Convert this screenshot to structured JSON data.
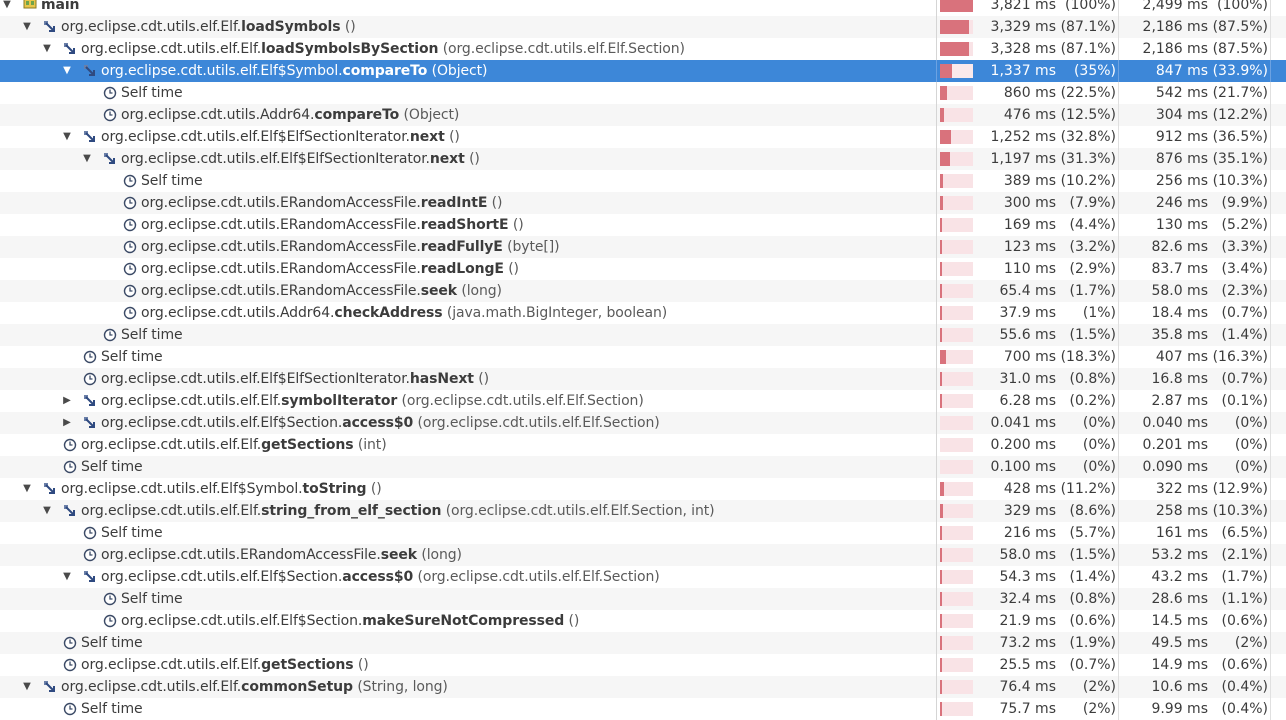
{
  "colors": {
    "selection": "#3d87d8",
    "bar_fill": "#d9727c",
    "bar_background": "#f9e3e6",
    "stripe": "#f6f6f6"
  },
  "rows": [
    {
      "name": "main",
      "args": "",
      "kind": "thread",
      "depth": 0,
      "expanded": true,
      "total_time": "3,821 ms",
      "total_pct": "(100%)",
      "cpu_time": "2,499 ms",
      "cpu_pct": "(100%)",
      "fraction": 1.0
    },
    {
      "prefix": "org.eclipse.cdt.utils.elf.Elf.",
      "name": "loadSymbols",
      "args": " ()",
      "kind": "method",
      "depth": 1,
      "expanded": true,
      "total_time": "3,329 ms",
      "total_pct": "(87.1%)",
      "cpu_time": "2,186 ms",
      "cpu_pct": "(87.5%)",
      "fraction": 0.871
    },
    {
      "prefix": "org.eclipse.cdt.utils.elf.Elf.",
      "name": "loadSymbolsBySection",
      "args": " (org.eclipse.cdt.utils.elf.Elf.Section)",
      "kind": "method",
      "depth": 2,
      "expanded": true,
      "total_time": "3,328 ms",
      "total_pct": "(87.1%)",
      "cpu_time": "2,186 ms",
      "cpu_pct": "(87.5%)",
      "fraction": 0.871
    },
    {
      "prefix": "org.eclipse.cdt.utils.elf.Elf$Symbol.",
      "name": "compareTo",
      "args": " (Object)",
      "kind": "method",
      "depth": 3,
      "expanded": true,
      "selected": true,
      "total_time": "1,337 ms",
      "total_pct": "(35%)",
      "cpu_time": "847 ms",
      "cpu_pct": "(33.9%)",
      "fraction": 0.35
    },
    {
      "prefix": "",
      "name": "",
      "plain": "Self time",
      "args": "",
      "kind": "self",
      "depth": 4,
      "total_time": "860 ms",
      "total_pct": "(22.5%)",
      "cpu_time": "542 ms",
      "cpu_pct": "(21.7%)",
      "fraction": 0.225
    },
    {
      "prefix": "org.eclipse.cdt.utils.Addr64.",
      "name": "compareTo",
      "args": " (Object)",
      "kind": "self",
      "depth": 4,
      "total_time": "476 ms",
      "total_pct": "(12.5%)",
      "cpu_time": "304 ms",
      "cpu_pct": "(12.2%)",
      "fraction": 0.125
    },
    {
      "prefix": "org.eclipse.cdt.utils.elf.Elf$ElfSectionIterator.",
      "name": "next",
      "args": " ()",
      "kind": "method",
      "depth": 3,
      "expanded": true,
      "total_time": "1,252 ms",
      "total_pct": "(32.8%)",
      "cpu_time": "912 ms",
      "cpu_pct": "(36.5%)",
      "fraction": 0.328
    },
    {
      "prefix": "org.eclipse.cdt.utils.elf.Elf$ElfSectionIterator.",
      "name": "next",
      "args": " ()",
      "kind": "method",
      "depth": 4,
      "expanded": true,
      "total_time": "1,197 ms",
      "total_pct": "(31.3%)",
      "cpu_time": "876 ms",
      "cpu_pct": "(35.1%)",
      "fraction": 0.313
    },
    {
      "prefix": "",
      "name": "",
      "plain": "Self time",
      "args": "",
      "kind": "self",
      "depth": 5,
      "total_time": "389 ms",
      "total_pct": "(10.2%)",
      "cpu_time": "256 ms",
      "cpu_pct": "(10.3%)",
      "fraction": 0.102
    },
    {
      "prefix": "org.eclipse.cdt.utils.ERandomAccessFile.",
      "name": "readIntE",
      "args": " ()",
      "kind": "self",
      "depth": 5,
      "total_time": "300 ms",
      "total_pct": "(7.9%)",
      "cpu_time": "246 ms",
      "cpu_pct": "(9.9%)",
      "fraction": 0.079
    },
    {
      "prefix": "org.eclipse.cdt.utils.ERandomAccessFile.",
      "name": "readShortE",
      "args": " ()",
      "kind": "self",
      "depth": 5,
      "total_time": "169 ms",
      "total_pct": "(4.4%)",
      "cpu_time": "130 ms",
      "cpu_pct": "(5.2%)",
      "fraction": 0.044
    },
    {
      "prefix": "org.eclipse.cdt.utils.ERandomAccessFile.",
      "name": "readFullyE",
      "args": " (byte[])",
      "kind": "self",
      "depth": 5,
      "total_time": "123 ms",
      "total_pct": "(3.2%)",
      "cpu_time": "82.6 ms",
      "cpu_pct": "(3.3%)",
      "fraction": 0.032
    },
    {
      "prefix": "org.eclipse.cdt.utils.ERandomAccessFile.",
      "name": "readLongE",
      "args": " ()",
      "kind": "self",
      "depth": 5,
      "total_time": "110 ms",
      "total_pct": "(2.9%)",
      "cpu_time": "83.7 ms",
      "cpu_pct": "(3.4%)",
      "fraction": 0.029
    },
    {
      "prefix": "org.eclipse.cdt.utils.ERandomAccessFile.",
      "name": "seek",
      "args": " (long)",
      "kind": "self",
      "depth": 5,
      "total_time": "65.4 ms",
      "total_pct": "(1.7%)",
      "cpu_time": "58.0 ms",
      "cpu_pct": "(2.3%)",
      "fraction": 0.017
    },
    {
      "prefix": "org.eclipse.cdt.utils.Addr64.",
      "name": "checkAddress",
      "args": " (java.math.BigInteger, boolean)",
      "kind": "self",
      "depth": 5,
      "total_time": "37.9 ms",
      "total_pct": "(1%)",
      "cpu_time": "18.4 ms",
      "cpu_pct": "(0.7%)",
      "fraction": 0.01
    },
    {
      "prefix": "",
      "name": "",
      "plain": "Self time",
      "args": "",
      "kind": "self",
      "depth": 4,
      "total_time": "55.6 ms",
      "total_pct": "(1.5%)",
      "cpu_time": "35.8 ms",
      "cpu_pct": "(1.4%)",
      "fraction": 0.015
    },
    {
      "prefix": "",
      "name": "",
      "plain": "Self time",
      "args": "",
      "kind": "self",
      "depth": 3,
      "total_time": "700 ms",
      "total_pct": "(18.3%)",
      "cpu_time": "407 ms",
      "cpu_pct": "(16.3%)",
      "fraction": 0.183
    },
    {
      "prefix": "org.eclipse.cdt.utils.elf.Elf$ElfSectionIterator.",
      "name": "hasNext",
      "args": " ()",
      "kind": "self",
      "depth": 3,
      "total_time": "31.0 ms",
      "total_pct": "(0.8%)",
      "cpu_time": "16.8 ms",
      "cpu_pct": "(0.7%)",
      "fraction": 0.008
    },
    {
      "prefix": "org.eclipse.cdt.utils.elf.Elf.",
      "name": "symbolIterator",
      "args": " (org.eclipse.cdt.utils.elf.Elf.Section)",
      "kind": "method",
      "depth": 3,
      "expanded": false,
      "total_time": "6.28 ms",
      "total_pct": "(0.2%)",
      "cpu_time": "2.87 ms",
      "cpu_pct": "(0.1%)",
      "fraction": 0.002
    },
    {
      "prefix": "org.eclipse.cdt.utils.elf.Elf$Section.",
      "name": "access$0",
      "args": " (org.eclipse.cdt.utils.elf.Elf.Section)",
      "kind": "method",
      "depth": 3,
      "expanded": false,
      "total_time": "0.041 ms",
      "total_pct": "(0%)",
      "cpu_time": "0.040 ms",
      "cpu_pct": "(0%)",
      "fraction": 0
    },
    {
      "prefix": "org.eclipse.cdt.utils.elf.Elf.",
      "name": "getSections",
      "args": " (int)",
      "kind": "self",
      "depth": 2,
      "total_time": "0.200 ms",
      "total_pct": "(0%)",
      "cpu_time": "0.201 ms",
      "cpu_pct": "(0%)",
      "fraction": 0
    },
    {
      "prefix": "",
      "name": "",
      "plain": "Self time",
      "args": "",
      "kind": "self",
      "depth": 2,
      "total_time": "0.100 ms",
      "total_pct": "(0%)",
      "cpu_time": "0.090 ms",
      "cpu_pct": "(0%)",
      "fraction": 0
    },
    {
      "prefix": "org.eclipse.cdt.utils.elf.Elf$Symbol.",
      "name": "toString",
      "args": " ()",
      "kind": "method",
      "depth": 1,
      "expanded": true,
      "total_time": "428 ms",
      "total_pct": "(11.2%)",
      "cpu_time": "322 ms",
      "cpu_pct": "(12.9%)",
      "fraction": 0.112
    },
    {
      "prefix": "org.eclipse.cdt.utils.elf.Elf.",
      "name": "string_from_elf_section",
      "args": " (org.eclipse.cdt.utils.elf.Elf.Section, int)",
      "kind": "method",
      "depth": 2,
      "expanded": true,
      "total_time": "329 ms",
      "total_pct": "(8.6%)",
      "cpu_time": "258 ms",
      "cpu_pct": "(10.3%)",
      "fraction": 0.086
    },
    {
      "prefix": "",
      "name": "",
      "plain": "Self time",
      "args": "",
      "kind": "self",
      "depth": 3,
      "total_time": "216 ms",
      "total_pct": "(5.7%)",
      "cpu_time": "161 ms",
      "cpu_pct": "(6.5%)",
      "fraction": 0.057
    },
    {
      "prefix": "org.eclipse.cdt.utils.ERandomAccessFile.",
      "name": "seek",
      "args": " (long)",
      "kind": "self",
      "depth": 3,
      "total_time": "58.0 ms",
      "total_pct": "(1.5%)",
      "cpu_time": "53.2 ms",
      "cpu_pct": "(2.1%)",
      "fraction": 0.015
    },
    {
      "prefix": "org.eclipse.cdt.utils.elf.Elf$Section.",
      "name": "access$0",
      "args": " (org.eclipse.cdt.utils.elf.Elf.Section)",
      "kind": "method",
      "depth": 3,
      "expanded": true,
      "total_time": "54.3 ms",
      "total_pct": "(1.4%)",
      "cpu_time": "43.2 ms",
      "cpu_pct": "(1.7%)",
      "fraction": 0.014
    },
    {
      "prefix": "",
      "name": "",
      "plain": "Self time",
      "args": "",
      "kind": "self",
      "depth": 4,
      "total_time": "32.4 ms",
      "total_pct": "(0.8%)",
      "cpu_time": "28.6 ms",
      "cpu_pct": "(1.1%)",
      "fraction": 0.008
    },
    {
      "prefix": "org.eclipse.cdt.utils.elf.Elf$Section.",
      "name": "makeSureNotCompressed",
      "args": " ()",
      "kind": "self",
      "depth": 4,
      "total_time": "21.9 ms",
      "total_pct": "(0.6%)",
      "cpu_time": "14.5 ms",
      "cpu_pct": "(0.6%)",
      "fraction": 0.006
    },
    {
      "prefix": "",
      "name": "",
      "plain": "Self time",
      "args": "",
      "kind": "self",
      "depth": 2,
      "total_time": "73.2 ms",
      "total_pct": "(1.9%)",
      "cpu_time": "49.5 ms",
      "cpu_pct": "(2%)",
      "fraction": 0.019
    },
    {
      "prefix": "org.eclipse.cdt.utils.elf.Elf.",
      "name": "getSections",
      "args": " ()",
      "kind": "self",
      "depth": 2,
      "total_time": "25.5 ms",
      "total_pct": "(0.7%)",
      "cpu_time": "14.9 ms",
      "cpu_pct": "(0.6%)",
      "fraction": 0.007
    },
    {
      "prefix": "org.eclipse.cdt.utils.elf.Elf.",
      "name": "commonSetup",
      "args": " (String, long)",
      "kind": "method",
      "depth": 1,
      "expanded": true,
      "total_time": "76.4 ms",
      "total_pct": "(2%)",
      "cpu_time": "10.6 ms",
      "cpu_pct": "(0.4%)",
      "fraction": 0.02
    },
    {
      "prefix": "",
      "name": "",
      "plain": "Self time",
      "args": "",
      "kind": "self",
      "depth": 2,
      "total_time": "75.7 ms",
      "total_pct": "(2%)",
      "cpu_time": "9.99 ms",
      "cpu_pct": "(0.4%)",
      "fraction": 0.02
    }
  ]
}
